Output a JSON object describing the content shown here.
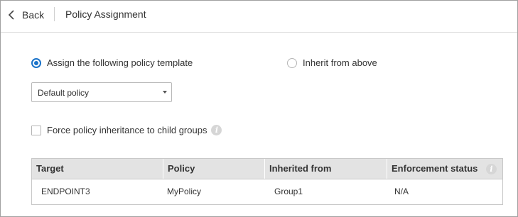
{
  "header": {
    "back_label": "Back",
    "title": "Policy Assignment"
  },
  "assignment": {
    "options": [
      {
        "label": "Assign the following policy template",
        "selected": true
      },
      {
        "label": "Inherit from above",
        "selected": false
      }
    ],
    "template_select": {
      "value": "Default policy"
    },
    "force_inheritance": {
      "label": "Force policy inheritance to child groups",
      "checked": false
    }
  },
  "table": {
    "columns": [
      "Target",
      "Policy",
      "Inherited from",
      "Enforcement status"
    ],
    "rows": [
      [
        "ENDPOINT3",
        "MyPolicy",
        "Group1",
        "N/A"
      ]
    ]
  },
  "icons": {
    "back": "chevron-left-icon",
    "info": "info-icon"
  },
  "colors": {
    "accent": "#1a73c9",
    "table_header_bg": "#e3e3e3"
  }
}
